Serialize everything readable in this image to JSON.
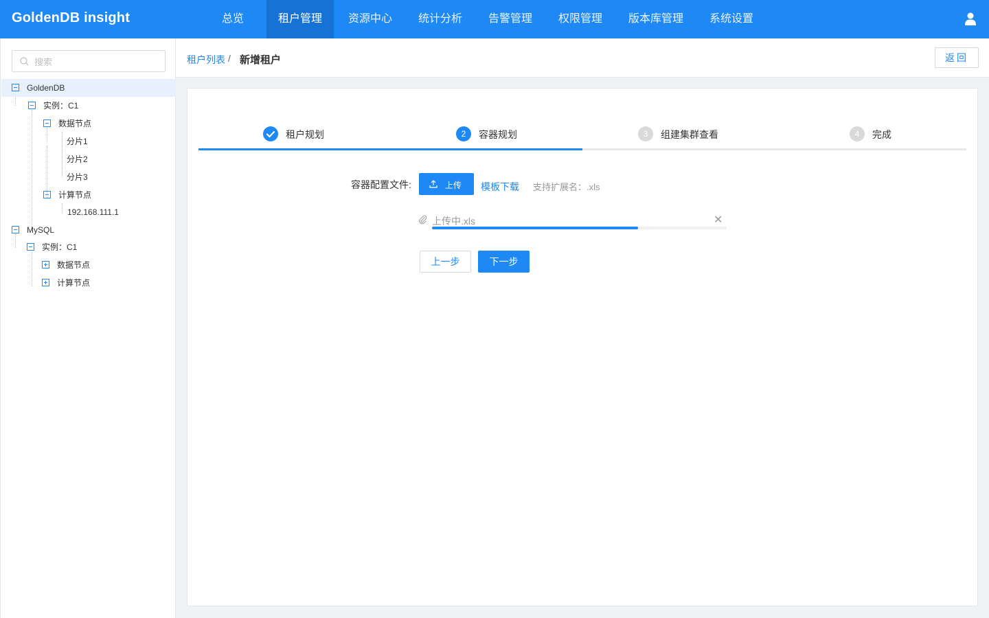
{
  "app": {
    "brand": "GoldenDB insight",
    "nav": [
      {
        "label": "总览",
        "active": false
      },
      {
        "label": "租户管理",
        "active": true
      },
      {
        "label": "资源中心",
        "active": false
      },
      {
        "label": "统计分析",
        "active": false
      },
      {
        "label": "告警管理",
        "active": false
      },
      {
        "label": "权限管理",
        "active": false
      },
      {
        "label": "版本库管理",
        "active": false
      },
      {
        "label": "系统设置",
        "active": false
      }
    ],
    "user_icon": "user-icon",
    "accent_color": "#1e88f5"
  },
  "sidebar": {
    "search_placeholder": "搜索",
    "tree": {
      "goldendb": "GoldenDB",
      "goldendb_instance": "实例：C1",
      "goldendb_data_nodes": "数据节点",
      "shard1": "分片1",
      "shard2": "分片2",
      "shard3": "分片3",
      "goldendb_compute_nodes": "计算节点",
      "compute_ip": "192.168.111.1",
      "mysql": "MySQL",
      "mysql_instance": "实例：C1",
      "mysql_data_nodes": "数据节点",
      "mysql_compute_nodes": "计算节点"
    }
  },
  "breadcrumb": {
    "parent": "租户列表",
    "separator": "/",
    "current": "新增租户",
    "back_label": "返回"
  },
  "steps": {
    "items": [
      {
        "index": "1",
        "label": "租户规划",
        "status": "done"
      },
      {
        "index": "2",
        "label": "容器规划",
        "status": "active"
      },
      {
        "index": "3",
        "label": "组建集群查看",
        "status": "wait"
      },
      {
        "index": "4",
        "label": "完成",
        "status": "wait"
      }
    ],
    "progress_fraction": 0.5
  },
  "form": {
    "label": "容器配置文件:",
    "upload_label": "上传",
    "template_link": "模板下载",
    "ext_hint": "支持扩展名：.xls",
    "file": {
      "name": "上传中.xls",
      "progress_fraction": 0.7
    },
    "prev_label": "上一步",
    "next_label": "下一步"
  }
}
